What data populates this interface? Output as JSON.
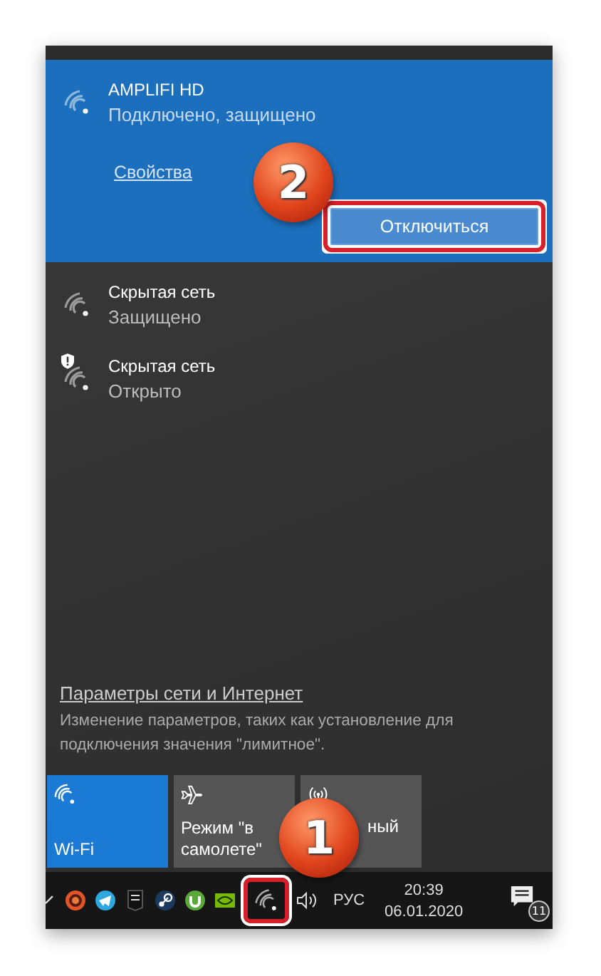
{
  "connected_network": {
    "name": "AMPLIFI HD",
    "status": "Подключено, защищено",
    "properties_link": "Свойства",
    "disconnect_button": "Отключиться",
    "highlighted": true
  },
  "networks": [
    {
      "name": "Скрытая сеть",
      "status": "Защищено",
      "warning": false
    },
    {
      "name": "Скрытая сеть",
      "status": "Открыто",
      "warning": true
    }
  ],
  "settings": {
    "link": "Параметры сети и Интернет",
    "description": "Изменение параметров, таких как установление для подключения значения \"лимитное\"."
  },
  "tiles": [
    {
      "kind": "wifi",
      "label": "Wi-Fi",
      "on": true
    },
    {
      "kind": "airplane",
      "label": "Режим \"в самолете\"",
      "on": false
    },
    {
      "kind": "hotspot",
      "label": "ный",
      "on": false
    }
  ],
  "taskbar": {
    "tray_icons": [
      {
        "kind": "chevron",
        "highlighted": false
      },
      {
        "kind": "browser",
        "highlighted": false
      },
      {
        "kind": "telegram",
        "highlighted": false
      },
      {
        "kind": "epic",
        "highlighted": false
      },
      {
        "kind": "steam",
        "highlighted": false
      },
      {
        "kind": "torrent",
        "highlighted": false
      },
      {
        "kind": "nvidia",
        "highlighted": false
      },
      {
        "kind": "wifi",
        "highlighted": true
      },
      {
        "kind": "volume",
        "highlighted": false
      }
    ],
    "language": "РУС",
    "time": "20:39",
    "date": "06.01.2020",
    "notification_count": "11"
  },
  "callouts": [
    {
      "label": "2"
    },
    {
      "label": "1"
    }
  ]
}
